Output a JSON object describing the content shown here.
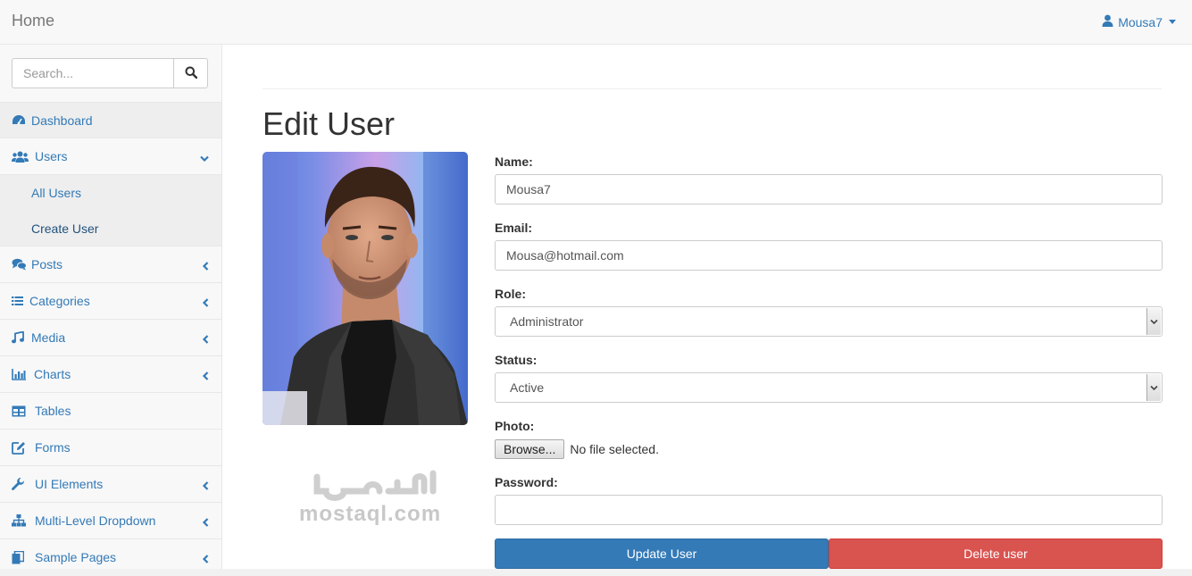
{
  "navbar": {
    "brand": "Home",
    "user_name": "Mousa7"
  },
  "sidebar": {
    "search_placeholder": "Search...",
    "items": [
      {
        "label": "Dashboard",
        "icon": "dashboard-icon"
      },
      {
        "label": "Users",
        "icon": "users-icon",
        "expanded": true
      },
      {
        "label": "Posts",
        "icon": "comments-icon"
      },
      {
        "label": "Categories",
        "icon": "list-icon"
      },
      {
        "label": "Media",
        "icon": "music-icon"
      },
      {
        "label": "Charts",
        "icon": "bar-chart-icon"
      },
      {
        "label": "Tables",
        "icon": "table-icon"
      },
      {
        "label": "Forms",
        "icon": "edit-icon"
      },
      {
        "label": "UI Elements",
        "icon": "wrench-icon"
      },
      {
        "label": "Multi-Level Dropdown",
        "icon": "sitemap-icon"
      },
      {
        "label": "Sample Pages",
        "icon": "files-icon"
      }
    ],
    "users_sub": [
      "All Users",
      "Create User"
    ]
  },
  "main": {
    "title": "Edit User",
    "form": {
      "name_label": "Name:",
      "name_value": "Mousa7",
      "email_label": "Email:",
      "email_value": "Mousa@hotmail.com",
      "role_label": "Role:",
      "role_value": "Administrator",
      "status_label": "Status:",
      "status_value": "Active",
      "photo_label": "Photo:",
      "browse_label": "Browse...",
      "file_status": "No file selected.",
      "password_label": "Password:",
      "password_value": "",
      "update_label": "Update User",
      "delete_label": "Delete user"
    }
  },
  "watermark": {
    "text": "mostaql.com"
  },
  "colors": {
    "link": "#337ab7",
    "primary": "#337ab7",
    "danger": "#d9534f"
  }
}
